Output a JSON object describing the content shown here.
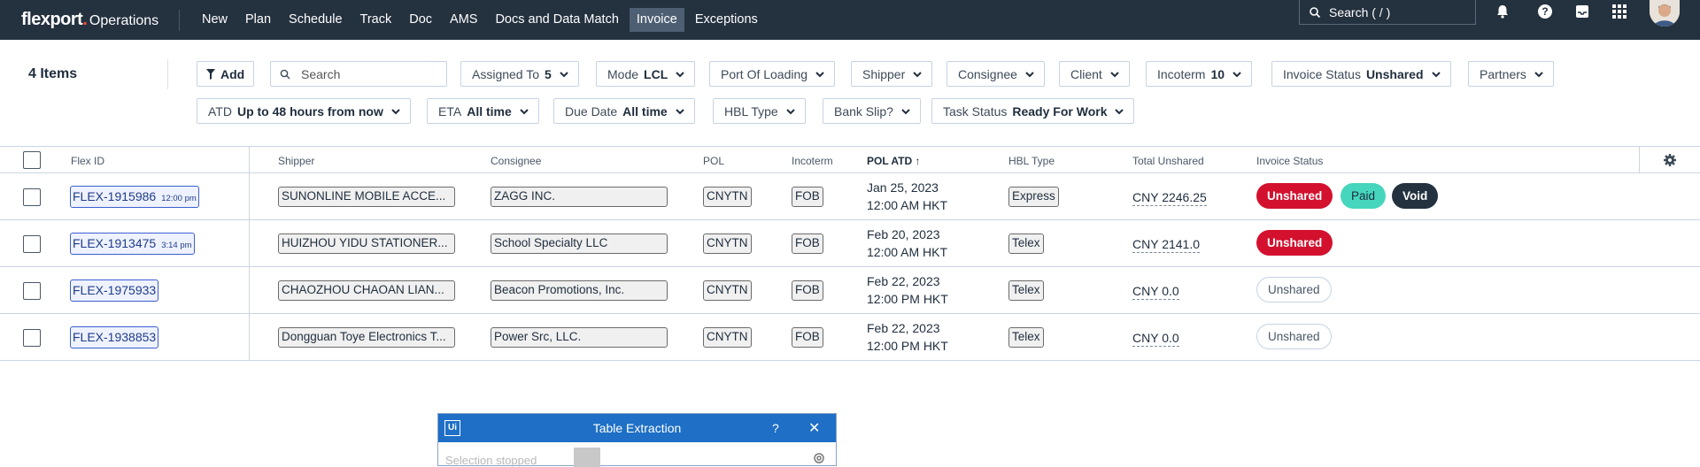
{
  "app": {
    "logo": "flexport",
    "logo_dot": ".",
    "subtitle": "Operations"
  },
  "nav": {
    "items": [
      "New",
      "Plan",
      "Schedule",
      "Track",
      "Doc",
      "AMS",
      "Docs and Data Match",
      "Invoice",
      "Exceptions"
    ],
    "active": "Invoice",
    "search_label": "Search ( / )"
  },
  "toolbar": {
    "items_count": "4 Items",
    "add_label": "Add",
    "search_placeholder": "Search",
    "filters_row1": [
      {
        "label": "Assigned To",
        "value": "5"
      },
      {
        "label": "Mode",
        "value": "LCL"
      },
      {
        "label": "Port Of Loading",
        "value": ""
      },
      {
        "label": "Shipper",
        "value": ""
      },
      {
        "label": "Consignee",
        "value": ""
      },
      {
        "label": "Client",
        "value": ""
      },
      {
        "label": "Incoterm",
        "value": "10"
      },
      {
        "label": "Invoice Status",
        "value": "Unshared"
      },
      {
        "label": "Partners",
        "value": ""
      }
    ],
    "filters_row2": [
      {
        "label": "ATD",
        "value": "Up to 48 hours from now"
      },
      {
        "label": "ETA",
        "value": "All time"
      },
      {
        "label": "Due Date",
        "value": "All time"
      },
      {
        "label": "HBL Type",
        "value": ""
      },
      {
        "label": "Bank Slip?",
        "value": ""
      },
      {
        "label": "Task Status",
        "value": "Ready For Work"
      }
    ]
  },
  "table": {
    "columns": {
      "flex_id": "Flex ID",
      "shipper": "Shipper",
      "consignee": "Consignee",
      "pol": "POL",
      "incoterm": "Incoterm",
      "pol_atd": "POL ATD",
      "sort_arrow": "↑",
      "hbl_type": "HBL Type",
      "total_unshared": "Total Unshared",
      "invoice_status": "Invoice Status"
    },
    "rows": [
      {
        "flex_id": "FLEX-1915986",
        "time": "12:00 pm",
        "shipper": "SUNONLINE MOBILE ACCE...",
        "consignee": "ZAGG INC.",
        "pol": "CNYTN",
        "incoterm": "FOB",
        "atd_date": "Jan 25, 2023",
        "atd_time": "12:00 AM HKT",
        "hbl": "Express",
        "total": "CNY 2246.25",
        "statuses": [
          {
            "label": "Unshared",
            "style": "red"
          },
          {
            "label": "Paid",
            "style": "teal"
          },
          {
            "label": "Void",
            "style": "dark"
          }
        ]
      },
      {
        "flex_id": "FLEX-1913475",
        "time": "3:14 pm",
        "shipper": "HUIZHOU YIDU STATIONER...",
        "consignee": "School Specialty LLC",
        "pol": "CNYTN",
        "incoterm": "FOB",
        "atd_date": "Feb 20, 2023",
        "atd_time": "12:00 AM HKT",
        "hbl": "Telex",
        "total": "CNY 2141.0",
        "statuses": [
          {
            "label": "Unshared",
            "style": "red"
          }
        ]
      },
      {
        "flex_id": "FLEX-1975933",
        "time": "",
        "shipper": "CHAOZHOU CHAOAN LIAN...",
        "consignee": "Beacon Promotions, Inc.",
        "pol": "CNYTN",
        "incoterm": "FOB",
        "atd_date": "Feb 22, 2023",
        "atd_time": "12:00 PM HKT",
        "hbl": "Telex",
        "total": "CNY 0.0",
        "statuses": [
          {
            "label": "Unshared",
            "style": "outline"
          }
        ]
      },
      {
        "flex_id": "FLEX-1938853",
        "time": "",
        "shipper": "Dongguan Toye Electronics T...",
        "consignee": "Power Src, LLC.",
        "pol": "CNYTN",
        "incoterm": "FOB",
        "atd_date": "Feb 22, 2023",
        "atd_time": "12:00 PM HKT",
        "hbl": "Telex",
        "total": "CNY 0.0",
        "statuses": [
          {
            "label": "Unshared",
            "style": "outline"
          }
        ]
      }
    ]
  },
  "dialog": {
    "logo": "Ui",
    "title": "Table Extraction",
    "help": "?",
    "close": "✕",
    "faded_text": "Selection stopped"
  },
  "colors": {
    "nav_bg": "#24313f",
    "accent_red": "#d3112f",
    "accent_teal": "#45d6bd",
    "dialog_blue": "#1e6fc5"
  }
}
